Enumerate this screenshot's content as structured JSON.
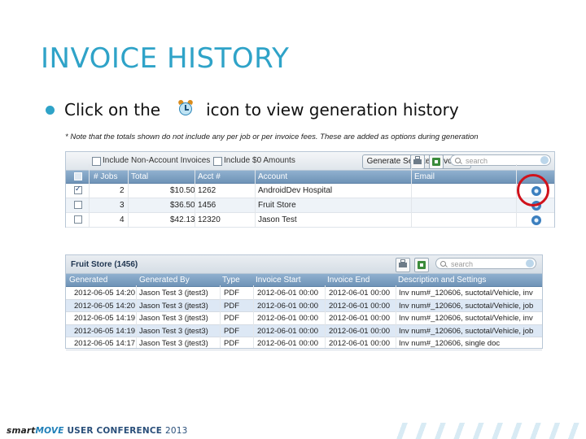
{
  "slide": {
    "title": "INVOICE HISTORY",
    "bullet_prefix": "Click on the",
    "bullet_suffix": "icon to view generation history",
    "bullet_icon": "alarm-clock-icon",
    "note": "* Note that the totals shown do not include any per job or per invoice fees. These are added as options during generation",
    "highlight_color": "#d0121b",
    "title_color": "#2fa3c8"
  },
  "invoices_grid": {
    "toolbar": {
      "include_non_account_label": "Include Non-Account Invoices",
      "include_zero_label": "Include $0 Amounts",
      "generate_button": "Generate Selected Invoices",
      "search_placeholder": "search"
    },
    "columns": [
      "# Jobs",
      "Total",
      "Acct #",
      "Account",
      "Email"
    ],
    "rows": [
      {
        "checked": true,
        "jobs": "2",
        "total": "$10.50",
        "acct": "1262",
        "account": "AndroidDev Hospital",
        "email": ""
      },
      {
        "checked": false,
        "jobs": "3",
        "total": "$36.50",
        "acct": "1456",
        "account": "Fruit Store",
        "email": ""
      },
      {
        "checked": false,
        "jobs": "4",
        "total": "$42.13",
        "acct": "12320",
        "account": "Jason Test",
        "email": ""
      }
    ]
  },
  "history_panel": {
    "title": "Fruit Store (1456)",
    "search_placeholder": "search",
    "columns": [
      "Generated",
      "Generated By",
      "Type",
      "Invoice Start",
      "Invoice End",
      "Description and Settings"
    ],
    "rows": [
      {
        "generated": "2012-06-05 14:20",
        "by": "Jason Test 3 (jtest3)",
        "type": "PDF",
        "start": "2012-06-01 00:00",
        "end": "2012-06-01 00:00",
        "desc": "Inv num#_120606, suctotal/Vehicle, inv"
      },
      {
        "generated": "2012-06-05 14:20",
        "by": "Jason Test 3 (jtest3)",
        "type": "PDF",
        "start": "2012-06-01 00:00",
        "end": "2012-06-01 00:00",
        "desc": "Inv num#_120606, suctotal/Vehicle, job"
      },
      {
        "generated": "2012-06-05 14:19",
        "by": "Jason Test 3 (jtest3)",
        "type": "PDF",
        "start": "2012-06-01 00:00",
        "end": "2012-06-01 00:00",
        "desc": "Inv num#_120606, suctotal/Vehicle, inv"
      },
      {
        "generated": "2012-06-05 14:19",
        "by": "Jason Test 3 (jtest3)",
        "type": "PDF",
        "start": "2012-06-01 00:00",
        "end": "2012-06-01 00:00",
        "desc": "Inv num#_120606, suctotal/Vehicle, job"
      },
      {
        "generated": "2012-06-05 14:17",
        "by": "Jason Test 3 (jtest3)",
        "type": "PDF",
        "start": "2012-06-01 00:00",
        "end": "2012-06-01 00:00",
        "desc": "Inv num#_120606, single doc"
      }
    ]
  },
  "footer": {
    "brand_smart": "smart",
    "brand_move": "MOVE",
    "conference": "USER CONFERENCE",
    "year": "2013"
  }
}
